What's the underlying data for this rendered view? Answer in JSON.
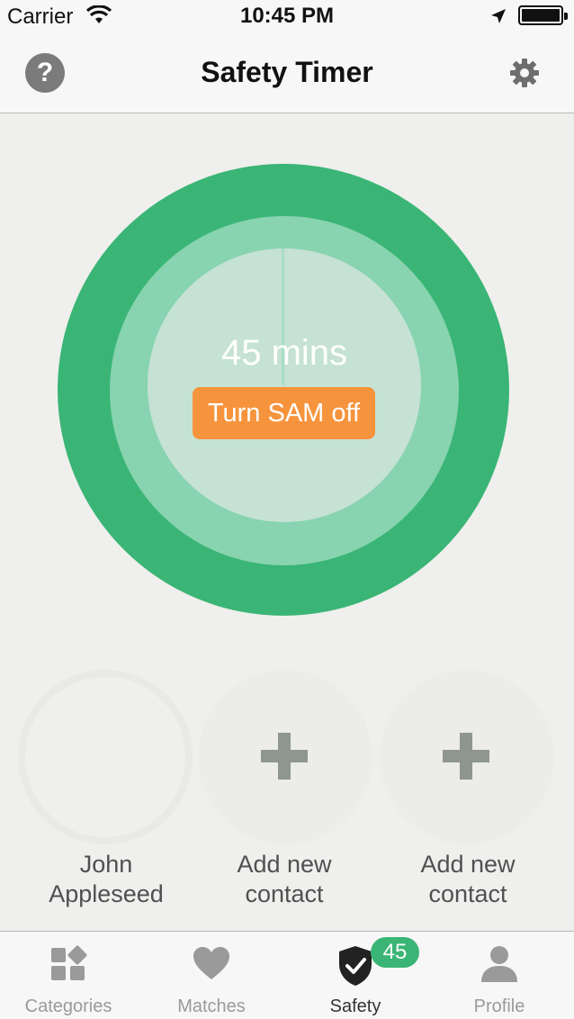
{
  "status_bar": {
    "carrier": "Carrier",
    "time": "10:45 PM"
  },
  "nav": {
    "title": "Safety Timer",
    "help_icon": "help-icon",
    "settings_icon": "gear-icon",
    "help_label": "?"
  },
  "timer": {
    "remaining_text": "45 mins",
    "toggle_label": "Turn SAM off",
    "colors": {
      "outer": "#3ab575",
      "middle": "#88d3b0",
      "inner": "#c5e2d4",
      "button": "#f6943d"
    }
  },
  "contacts": [
    {
      "name": "John Appleseed",
      "line1": "John",
      "line2": "Appleseed",
      "is_add": false
    },
    {
      "name": "Add new contact",
      "line1": "Add new",
      "line2": "contact",
      "is_add": true,
      "icon": "plus-icon"
    },
    {
      "name": "Add new contact",
      "line1": "Add new",
      "line2": "contact",
      "is_add": true,
      "icon": "plus-icon"
    }
  ],
  "tabs": [
    {
      "label": "Categories",
      "icon": "categories-icon",
      "active": false
    },
    {
      "label": "Matches",
      "icon": "heart-icon",
      "active": false
    },
    {
      "label": "Safety",
      "icon": "shield-check-icon",
      "active": true,
      "badge": "45"
    },
    {
      "label": "Profile",
      "icon": "person-icon",
      "active": false
    }
  ]
}
